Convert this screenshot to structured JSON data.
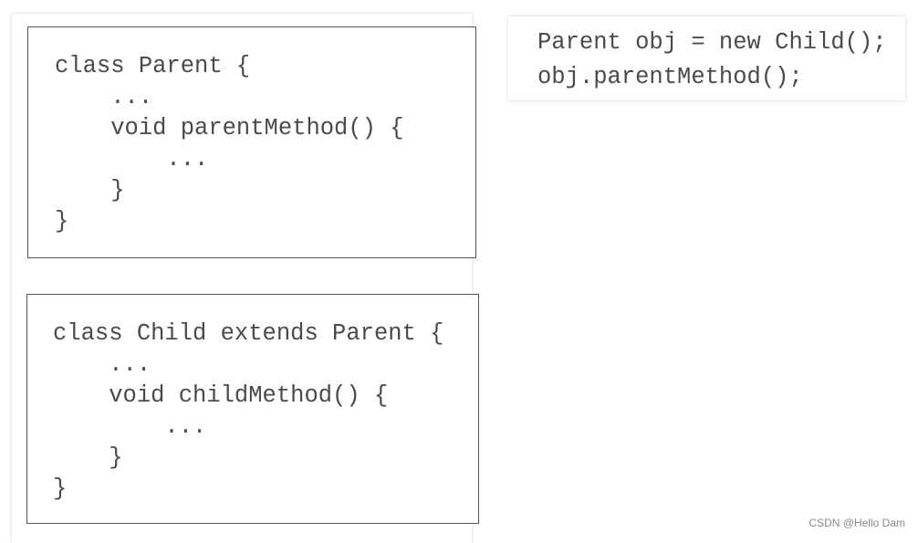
{
  "parent_class": {
    "lines": [
      "class Parent {",
      "    ...",
      "    void parentMethod() {",
      "        ...",
      "    }",
      "}"
    ]
  },
  "child_class": {
    "lines": [
      "class Child extends Parent {",
      "    ...",
      "    void childMethod() {",
      "        ...",
      "    }",
      "}"
    ]
  },
  "usage": {
    "lines": [
      "Parent obj = new Child();",
      "obj.parentMethod();"
    ]
  },
  "watermark": "CSDN @Hello Dam"
}
